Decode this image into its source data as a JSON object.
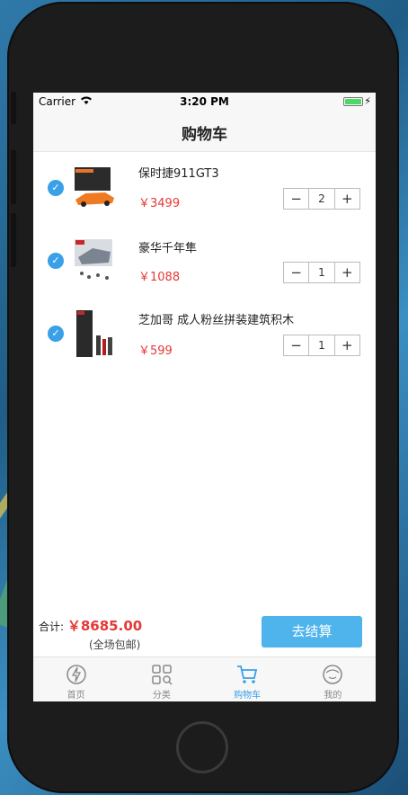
{
  "status_bar": {
    "carrier": "Carrier",
    "time": "3:20 PM"
  },
  "navbar": {
    "title": "购物车"
  },
  "cart_items": [
    {
      "name": "保时捷911GT3",
      "price": "￥3499",
      "qty": "2",
      "checked": true
    },
    {
      "name": "豪华千年隼",
      "price": "￥1088",
      "qty": "1",
      "checked": true
    },
    {
      "name": "芝加哥 成人粉丝拼装建筑积木",
      "price": "￥599",
      "qty": "1",
      "checked": true
    }
  ],
  "footer": {
    "total_label": "合计:",
    "total_amount": "￥8685.00",
    "shipping_note": "(全场包邮)",
    "checkout_label": "去结算"
  },
  "tabs": [
    {
      "label": "首页",
      "icon": "lightning-icon"
    },
    {
      "label": "分类",
      "icon": "grid-icon"
    },
    {
      "label": "购物车",
      "icon": "cart-icon",
      "active": true
    },
    {
      "label": "我的",
      "icon": "face-icon"
    }
  ],
  "colors": {
    "accent": "#3aa0e8",
    "price": "#e53935",
    "checkout": "#4fb4ec"
  }
}
